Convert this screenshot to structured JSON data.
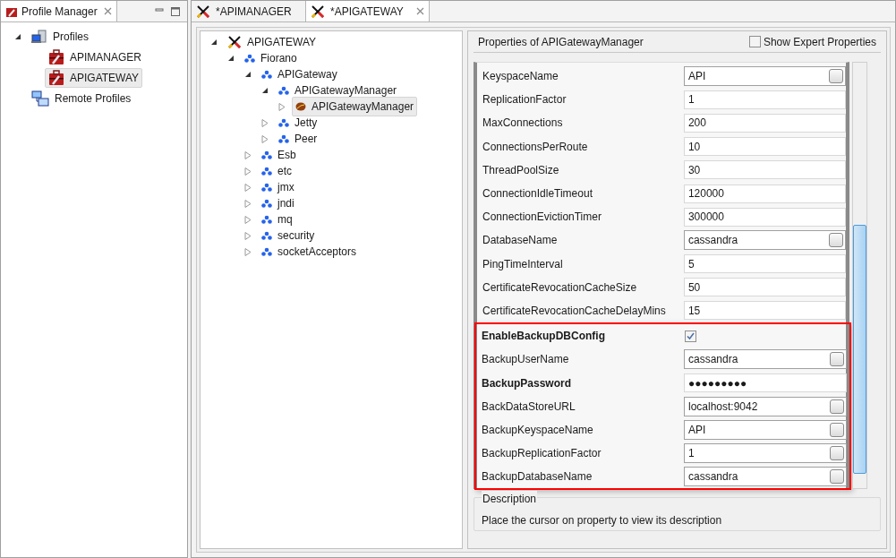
{
  "profile_manager": {
    "tab": {
      "label": "Profile Manager"
    },
    "tree": [
      {
        "label": "Profiles",
        "kind": "computer",
        "expanded": true,
        "selected": false,
        "children": [
          {
            "label": "APIMANAGER",
            "kind": "toolbox",
            "selected": false
          },
          {
            "label": "APIGATEWAY",
            "kind": "toolbox",
            "selected": true
          }
        ]
      },
      {
        "label": "Remote Profiles",
        "kind": "remote",
        "selected": false
      }
    ]
  },
  "editor_tabs": [
    {
      "label": "*APIMANAGER",
      "selected": false
    },
    {
      "label": "*APIGATEWAY",
      "selected": true
    }
  ],
  "config_tree": [
    {
      "label": "APIGATEWAY",
      "kind": "tools",
      "expanded": true,
      "selected": false,
      "children": [
        {
          "label": "Fiorano",
          "kind": "cluster",
          "expanded": true,
          "selected": false,
          "children": [
            {
              "label": "APIGateway",
              "kind": "cluster",
              "expanded": true,
              "selected": false,
              "children": [
                {
                  "label": "APIGatewayManager",
                  "kind": "cluster",
                  "expanded": true,
                  "selected": false,
                  "children": [
                    {
                      "label": "APIGatewayManager",
                      "kind": "bean",
                      "expanded": false,
                      "selected": true
                    }
                  ]
                },
                {
                  "label": "Jetty",
                  "kind": "cluster",
                  "expanded": false,
                  "selected": false
                },
                {
                  "label": "Peer",
                  "kind": "cluster",
                  "expanded": false,
                  "selected": false
                }
              ]
            },
            {
              "label": "Esb",
              "kind": "cluster",
              "expanded": false,
              "selected": false
            },
            {
              "label": "etc",
              "kind": "cluster",
              "expanded": false,
              "selected": false
            },
            {
              "label": "jmx",
              "kind": "cluster",
              "expanded": false,
              "selected": false
            },
            {
              "label": "jndi",
              "kind": "cluster",
              "expanded": false,
              "selected": false
            },
            {
              "label": "mq",
              "kind": "cluster",
              "expanded": false,
              "selected": false
            },
            {
              "label": "security",
              "kind": "cluster",
              "expanded": false,
              "selected": false
            },
            {
              "label": "socketAcceptors",
              "kind": "cluster",
              "expanded": false,
              "selected": false
            }
          ]
        }
      ]
    }
  ],
  "properties": {
    "title": "Properties of APIGatewayManager",
    "show_expert": {
      "label": "Show Expert Properties",
      "checked": false
    },
    "rows": [
      {
        "name": "KeyspaceName",
        "kind": "button",
        "value": "API",
        "bold": false
      },
      {
        "name": "ReplicationFactor",
        "kind": "text",
        "value": "1",
        "bold": false
      },
      {
        "name": "MaxConnections",
        "kind": "text",
        "value": "200",
        "bold": false
      },
      {
        "name": "ConnectionsPerRoute",
        "kind": "text",
        "value": "10",
        "bold": false
      },
      {
        "name": "ThreadPoolSize",
        "kind": "text",
        "value": "30",
        "bold": false
      },
      {
        "name": "ConnectionIdleTimeout",
        "kind": "text",
        "value": "120000",
        "bold": false
      },
      {
        "name": "ConnectionEvictionTimer",
        "kind": "text",
        "value": "300000",
        "bold": false
      },
      {
        "name": "DatabaseName",
        "kind": "button",
        "value": "cassandra",
        "bold": false
      },
      {
        "name": "PingTimeInterval",
        "kind": "text",
        "value": "5",
        "bold": false
      },
      {
        "name": "CertificateRevocationCacheSize",
        "kind": "text",
        "value": "50",
        "bold": false
      },
      {
        "name": "CertificateRevocationCacheDelayMins",
        "kind": "text",
        "value": "15",
        "bold": false
      }
    ],
    "highlighted_rows": [
      {
        "name": "EnableBackupDBConfig",
        "kind": "checkbox",
        "checked": true,
        "bold": true
      },
      {
        "name": "BackupUserName",
        "kind": "button",
        "value": "cassandra",
        "bold": false
      },
      {
        "name": "BackupPassword",
        "kind": "text",
        "value": "●●●●●●●●●",
        "bold": true
      },
      {
        "name": "BackDataStoreURL",
        "kind": "button",
        "value": "localhost:9042",
        "bold": false
      },
      {
        "name": "BackupKeyspaceName",
        "kind": "button",
        "value": "API",
        "bold": false
      },
      {
        "name": "BackupReplicationFactor",
        "kind": "button",
        "value": "1",
        "bold": false
      },
      {
        "name": "BackupDatabaseName",
        "kind": "button",
        "value": "cassandra",
        "bold": false
      }
    ],
    "description": {
      "title": "Description",
      "text": "Place the cursor on property to view its description"
    }
  }
}
